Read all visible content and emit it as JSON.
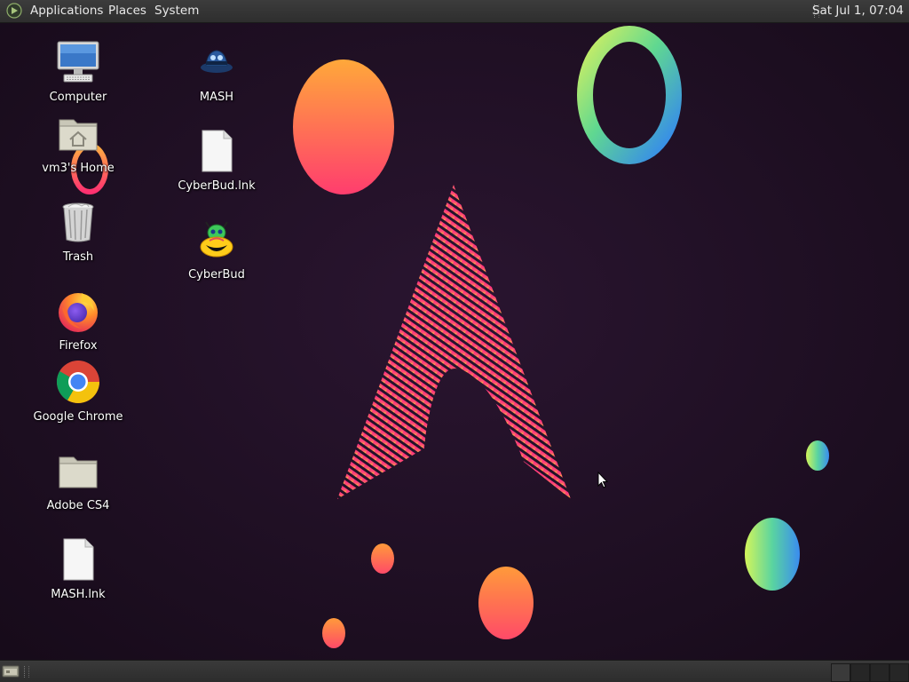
{
  "top_panel": {
    "menus": [
      "Applications",
      "Places",
      "System"
    ],
    "clock": "Sat Jul  1, 07:04"
  },
  "desktop": {
    "icons": [
      {
        "label": "Computer",
        "icon": "computer-icon"
      },
      {
        "label": "vm3's Home",
        "icon": "home-folder-icon"
      },
      {
        "label": "Trash",
        "icon": "trash-icon"
      },
      {
        "label": "Firefox",
        "icon": "firefox-icon"
      },
      {
        "label": "Google Chrome",
        "icon": "chrome-icon"
      },
      {
        "label": "Adobe CS4",
        "icon": "folder-icon"
      },
      {
        "label": "MASH.lnk",
        "icon": "file-icon"
      },
      {
        "label": "MASH",
        "icon": "mash-icon"
      },
      {
        "label": "CyberBud.lnk",
        "icon": "file-icon"
      },
      {
        "label": "CyberBud",
        "icon": "cyberbud-icon"
      }
    ]
  },
  "colors": {
    "panel": "#333333",
    "background": "#1c0f1f",
    "accent_pink": "#ff2d7a",
    "accent_orange": "#ffb03a"
  }
}
